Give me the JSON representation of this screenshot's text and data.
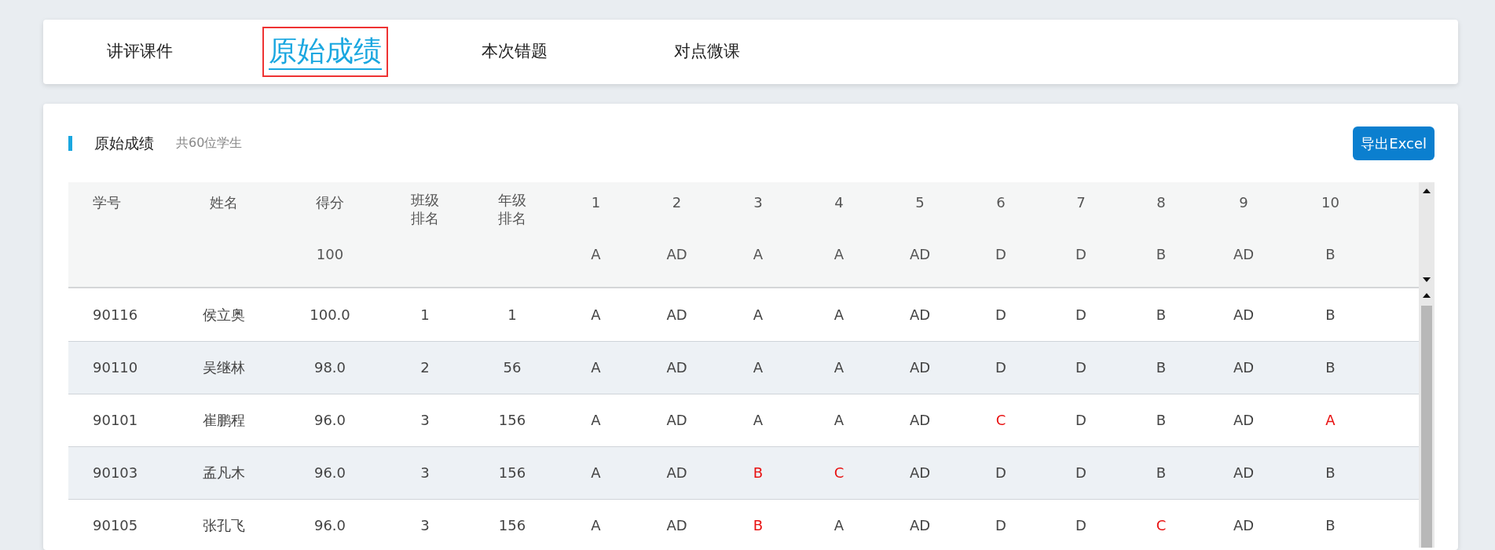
{
  "tabs": [
    {
      "label": "讲评课件",
      "selected": false
    },
    {
      "label": "原始成绩",
      "selected": true
    },
    {
      "label": "本次错题",
      "selected": false
    },
    {
      "label": "对点微课",
      "selected": false
    }
  ],
  "section": {
    "title": "原始成绩",
    "subtitle": "共60位学生",
    "export_button": "导出Excel"
  },
  "table": {
    "columns": [
      {
        "label": "学号"
      },
      {
        "label": "姓名"
      },
      {
        "label": "得分",
        "sub": "100"
      },
      {
        "label": "班级排名"
      },
      {
        "label": "年级排名"
      },
      {
        "label": "1",
        "sub": "A"
      },
      {
        "label": "2",
        "sub": "AD"
      },
      {
        "label": "3",
        "sub": "A"
      },
      {
        "label": "4",
        "sub": "A"
      },
      {
        "label": "5",
        "sub": "AD"
      },
      {
        "label": "6",
        "sub": "D"
      },
      {
        "label": "7",
        "sub": "D"
      },
      {
        "label": "8",
        "sub": "B"
      },
      {
        "label": "9",
        "sub": "AD"
      },
      {
        "label": "10",
        "sub": "B"
      }
    ],
    "rows": [
      {
        "id": "90116",
        "name": "侯立奥",
        "score": "100.0",
        "class_rank": "1",
        "grade_rank": "1",
        "answers": [
          {
            "value": "A",
            "wrong": false
          },
          {
            "value": "AD",
            "wrong": false
          },
          {
            "value": "A",
            "wrong": false
          },
          {
            "value": "A",
            "wrong": false
          },
          {
            "value": "AD",
            "wrong": false
          },
          {
            "value": "D",
            "wrong": false
          },
          {
            "value": "D",
            "wrong": false
          },
          {
            "value": "B",
            "wrong": false
          },
          {
            "value": "AD",
            "wrong": false
          },
          {
            "value": "B",
            "wrong": false
          }
        ]
      },
      {
        "id": "90110",
        "name": "吴继林",
        "score": "98.0",
        "class_rank": "2",
        "grade_rank": "56",
        "answers": [
          {
            "value": "A",
            "wrong": false
          },
          {
            "value": "AD",
            "wrong": false
          },
          {
            "value": "A",
            "wrong": false
          },
          {
            "value": "A",
            "wrong": false
          },
          {
            "value": "AD",
            "wrong": false
          },
          {
            "value": "D",
            "wrong": false
          },
          {
            "value": "D",
            "wrong": false
          },
          {
            "value": "B",
            "wrong": false
          },
          {
            "value": "AD",
            "wrong": false
          },
          {
            "value": "B",
            "wrong": false
          }
        ]
      },
      {
        "id": "90101",
        "name": "崔鹏程",
        "score": "96.0",
        "class_rank": "3",
        "grade_rank": "156",
        "answers": [
          {
            "value": "A",
            "wrong": false
          },
          {
            "value": "AD",
            "wrong": false
          },
          {
            "value": "A",
            "wrong": false
          },
          {
            "value": "A",
            "wrong": false
          },
          {
            "value": "AD",
            "wrong": false
          },
          {
            "value": "C",
            "wrong": true
          },
          {
            "value": "D",
            "wrong": false
          },
          {
            "value": "B",
            "wrong": false
          },
          {
            "value": "AD",
            "wrong": false
          },
          {
            "value": "A",
            "wrong": true
          }
        ]
      },
      {
        "id": "90103",
        "name": "孟凡木",
        "score": "96.0",
        "class_rank": "3",
        "grade_rank": "156",
        "answers": [
          {
            "value": "A",
            "wrong": false
          },
          {
            "value": "AD",
            "wrong": false
          },
          {
            "value": "B",
            "wrong": true
          },
          {
            "value": "C",
            "wrong": true
          },
          {
            "value": "AD",
            "wrong": false
          },
          {
            "value": "D",
            "wrong": false
          },
          {
            "value": "D",
            "wrong": false
          },
          {
            "value": "B",
            "wrong": false
          },
          {
            "value": "AD",
            "wrong": false
          },
          {
            "value": "B",
            "wrong": false
          }
        ]
      },
      {
        "id": "90105",
        "name": "张孔飞",
        "score": "96.0",
        "class_rank": "3",
        "grade_rank": "156",
        "answers": [
          {
            "value": "A",
            "wrong": false
          },
          {
            "value": "AD",
            "wrong": false
          },
          {
            "value": "B",
            "wrong": true
          },
          {
            "value": "A",
            "wrong": false
          },
          {
            "value": "AD",
            "wrong": false
          },
          {
            "value": "D",
            "wrong": false
          },
          {
            "value": "D",
            "wrong": false
          },
          {
            "value": "C",
            "wrong": true
          },
          {
            "value": "AD",
            "wrong": false
          },
          {
            "value": "B",
            "wrong": false
          }
        ]
      }
    ]
  }
}
